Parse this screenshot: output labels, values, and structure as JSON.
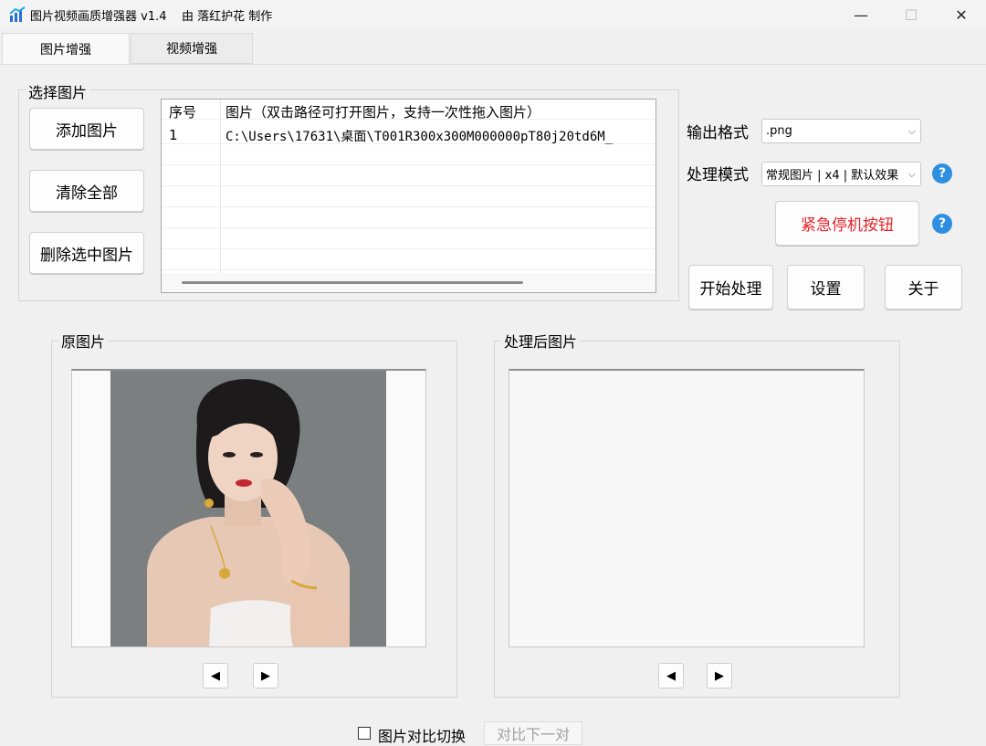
{
  "window": {
    "title": "图片视频画质增强器 v1.4    由 落红护花 制作",
    "minimize": "—",
    "maximize": "☐",
    "close": "✕"
  },
  "tabs": [
    {
      "label": "图片增强",
      "active": true
    },
    {
      "label": "视频增强",
      "active": false
    }
  ],
  "select_group": {
    "title": "选择图片",
    "buttons": {
      "add": "添加图片",
      "clear": "清除全部",
      "delete": "删除选中图片"
    }
  },
  "list": {
    "headers": [
      "序号",
      "图片（双击路径可打开图片，支持一次性拖入图片）"
    ],
    "rows": [
      [
        "1",
        "C:\\Users\\17631\\桌面\\T001R300x300M000000pT80j20td6M_"
      ]
    ]
  },
  "controls": {
    "format_label": "输出格式",
    "format_value": ".png",
    "mode_label": "处理模式",
    "mode_value": "常规图片 | x4 | 默认效果",
    "help_glyph": "?",
    "stop_label": "紧急停机按钮",
    "start_label": "开始处理",
    "settings_label": "设置",
    "about_label": "关于"
  },
  "panels": {
    "original_title": "原图片",
    "processed_title": "处理后图片",
    "prev_glyph": "◀",
    "next_glyph": "▶"
  },
  "bottom": {
    "compare_label": "图片对比切换",
    "compare_checked": false,
    "next_pair_label": "对比下一对"
  },
  "colors": {
    "stop_text": "#e8232a",
    "help_icon": "#2e8fe0"
  }
}
